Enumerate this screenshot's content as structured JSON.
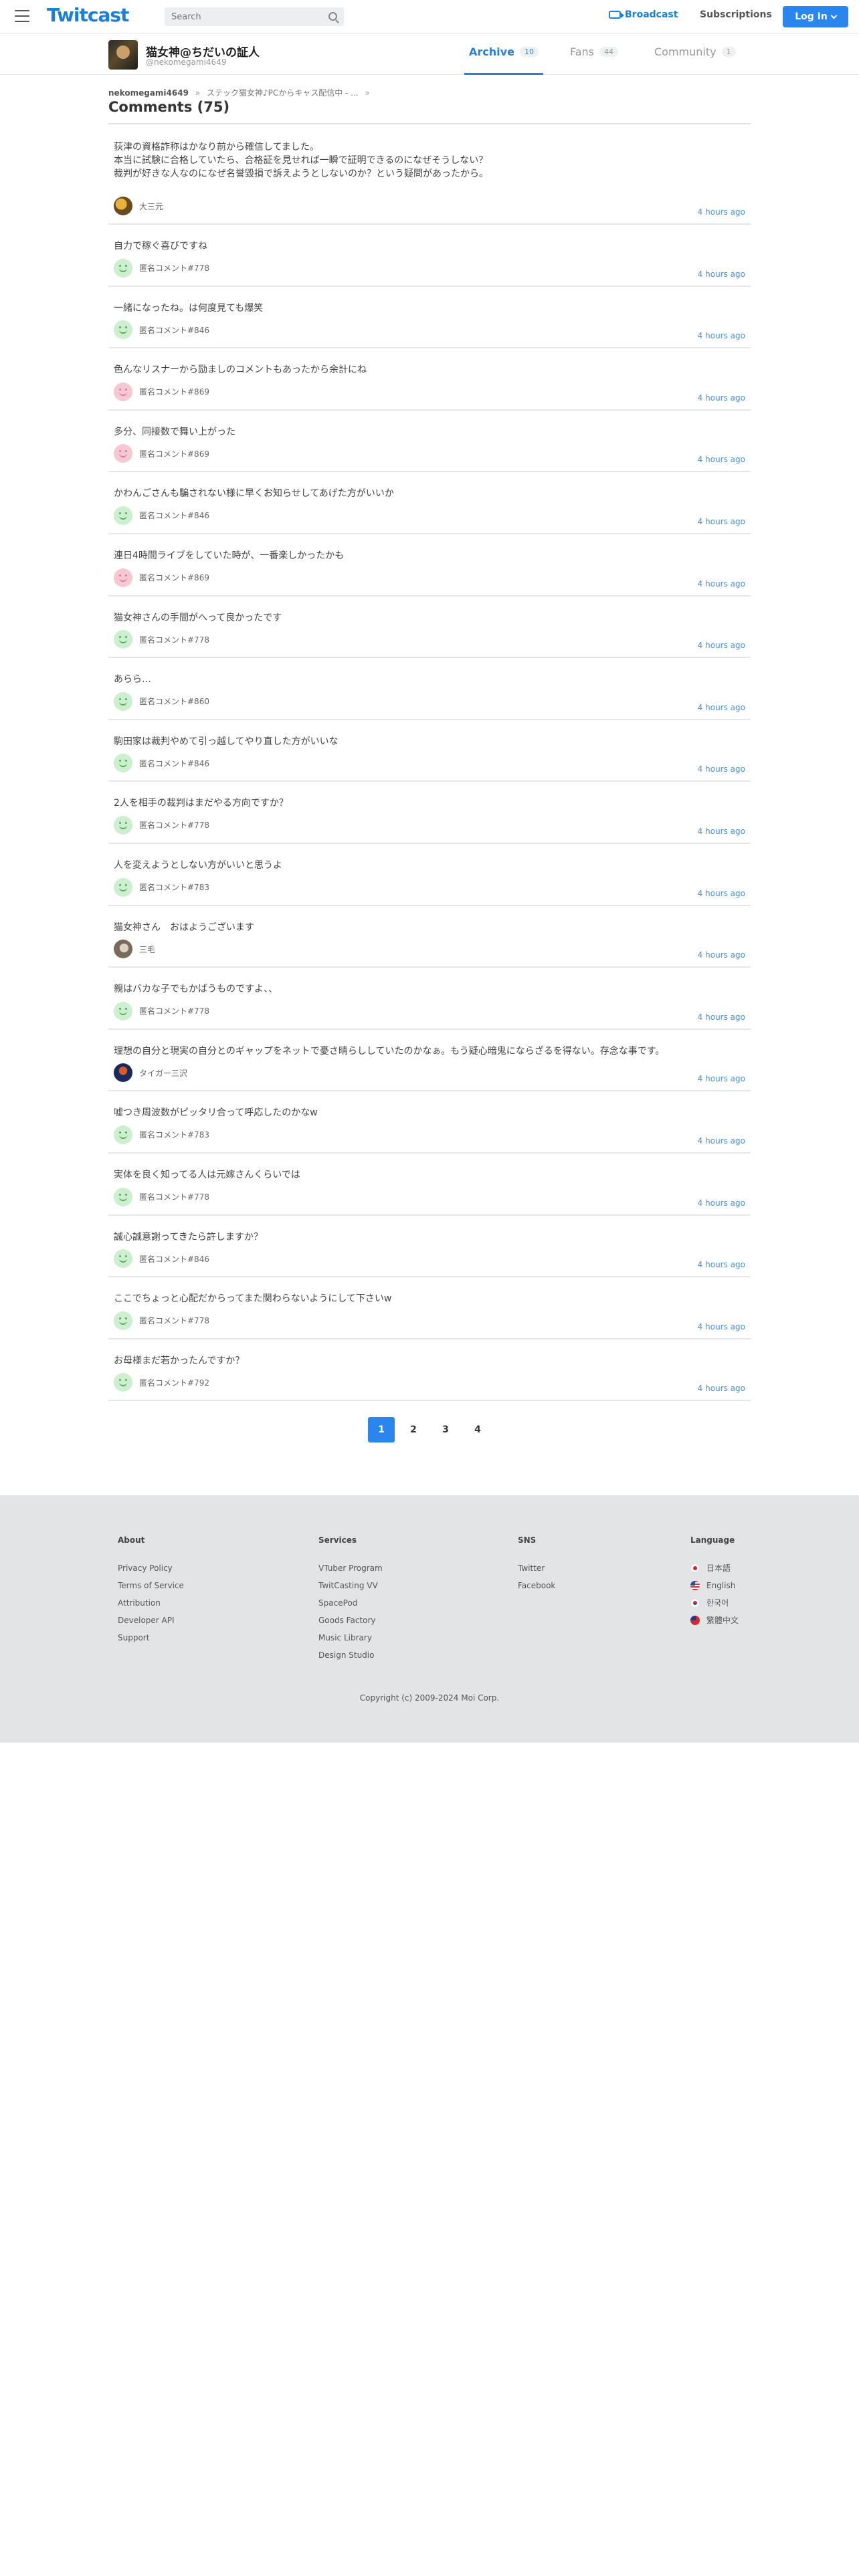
{
  "header": {
    "logo": "Twitcast",
    "search_placeholder": "Search",
    "broadcast_label": "Broadcast",
    "subscriptions_label": "Subscriptions",
    "login_label": "Log In"
  },
  "profile": {
    "name": "猫女神@ちだいの証人",
    "handle": "@nekomegami4649",
    "tabs": [
      {
        "label": "Archive",
        "count": "10"
      },
      {
        "label": "Fans",
        "count": "44"
      },
      {
        "label": "Community",
        "count": "1"
      }
    ]
  },
  "breadcrumb": {
    "user": "nekomegami4649",
    "sep": "»",
    "item": "ステック猫女神♪PCからキャス配信中 - ...",
    "tail": "»"
  },
  "page_title": "Comments (75)",
  "comments": [
    {
      "text": "荻津の資格詐称はかなり前から確信してました。\n本当に試験に合格していたら、合格証を見せれば一瞬で証明できるのになぜそうしない？\n裁判が好きな人なのになぜ名誉毀損で訴えようとしないのか？という疑問があったから。",
      "user": "大三元",
      "time": "4 hours ago",
      "avatar": "photo1"
    },
    {
      "text": "自力で稼ぐ喜びですね",
      "user": "匿名コメント#778",
      "time": "4 hours ago",
      "avatar": "green"
    },
    {
      "text": "一緒になったね。は何度見ても爆笑",
      "user": "匿名コメント#846",
      "time": "4 hours ago",
      "avatar": "green"
    },
    {
      "text": "色んなリスナーから励ましのコメントもあったから余計にね",
      "user": "匿名コメント#869",
      "time": "4 hours ago",
      "avatar": "pink"
    },
    {
      "text": "多分、同接数で舞い上がった",
      "user": "匿名コメント#869",
      "time": "4 hours ago",
      "avatar": "pink"
    },
    {
      "text": "かわんごさんも騙されない様に早くお知らせしてあげた方がいいか",
      "user": "匿名コメント#846",
      "time": "4 hours ago",
      "avatar": "green"
    },
    {
      "text": "連日4時間ライブをしていた時が、一番楽しかったかも",
      "user": "匿名コメント#869",
      "time": "4 hours ago",
      "avatar": "pink"
    },
    {
      "text": "猫女神さんの手間がへって良かったです",
      "user": "匿名コメント#778",
      "time": "4 hours ago",
      "avatar": "green"
    },
    {
      "text": "あらら…",
      "user": "匿名コメント#860",
      "time": "4 hours ago",
      "avatar": "green"
    },
    {
      "text": "駒田家は裁判やめて引っ越してやり直した方がいいな",
      "user": "匿名コメント#846",
      "time": "4 hours ago",
      "avatar": "green"
    },
    {
      "text": "2人を相手の裁判はまだやる方向ですか？",
      "user": "匿名コメント#778",
      "time": "4 hours ago",
      "avatar": "green"
    },
    {
      "text": "人を変えようとしない方がいいと思うよ",
      "user": "匿名コメント#783",
      "time": "4 hours ago",
      "avatar": "green"
    },
    {
      "text": "猫女神さん　おはようございます",
      "user": "三毛",
      "time": "4 hours ago",
      "avatar": "photo2"
    },
    {
      "text": "親はバカな子でもかばうものですよ、、",
      "user": "匿名コメント#778",
      "time": "4 hours ago",
      "avatar": "green"
    },
    {
      "text": "理想の自分と現実の自分とのギャップをネットで憂さ晴らししていたのかなぁ。もう疑心暗鬼にならざるを得ない。存念な事です。",
      "user": "タイガー三沢",
      "time": "4 hours ago",
      "avatar": "photo3"
    },
    {
      "text": "嘘つき周波数がピッタリ合って呼応したのかなw",
      "user": "匿名コメント#783",
      "time": "4 hours ago",
      "avatar": "green"
    },
    {
      "text": "実体を良く知ってる人は元嫁さんくらいでは",
      "user": "匿名コメント#778",
      "time": "4 hours ago",
      "avatar": "green"
    },
    {
      "text": "誠心誠意謝ってきたら許しますか？",
      "user": "匿名コメント#846",
      "time": "4 hours ago",
      "avatar": "green"
    },
    {
      "text": "ここでちょっと心配だからってまた関わらないようにして下さいw",
      "user": "匿名コメント#778",
      "time": "4 hours ago",
      "avatar": "green"
    },
    {
      "text": "お母様まだ若かったんですか？",
      "user": "匿名コメント#792",
      "time": "4 hours ago",
      "avatar": "green"
    }
  ],
  "pagination": [
    "1",
    "2",
    "3",
    "4"
  ],
  "pagination_active": "1",
  "footer": {
    "about": {
      "title": "About",
      "links": [
        "Privacy Policy",
        "Terms of Service",
        "Attribution",
        "Developer API",
        "Support"
      ]
    },
    "services": {
      "title": "Services",
      "links": [
        "VTuber Program",
        "TwitCasting VV",
        "SpacePod",
        "Goods Factory",
        "Music Library",
        "Design Studio"
      ]
    },
    "sns": {
      "title": "SNS",
      "links": [
        "Twitter",
        "Facebook"
      ]
    },
    "language": {
      "title": "Language",
      "items": [
        "日本語",
        "English",
        "한국어",
        "繁體中文"
      ]
    },
    "copyright": "Copyright (c) 2009-2024 Moi Corp."
  },
  "colors": {
    "accent": "#2a86ec",
    "link": "#4a90d9",
    "footer_bg": "#e2e4e6"
  }
}
